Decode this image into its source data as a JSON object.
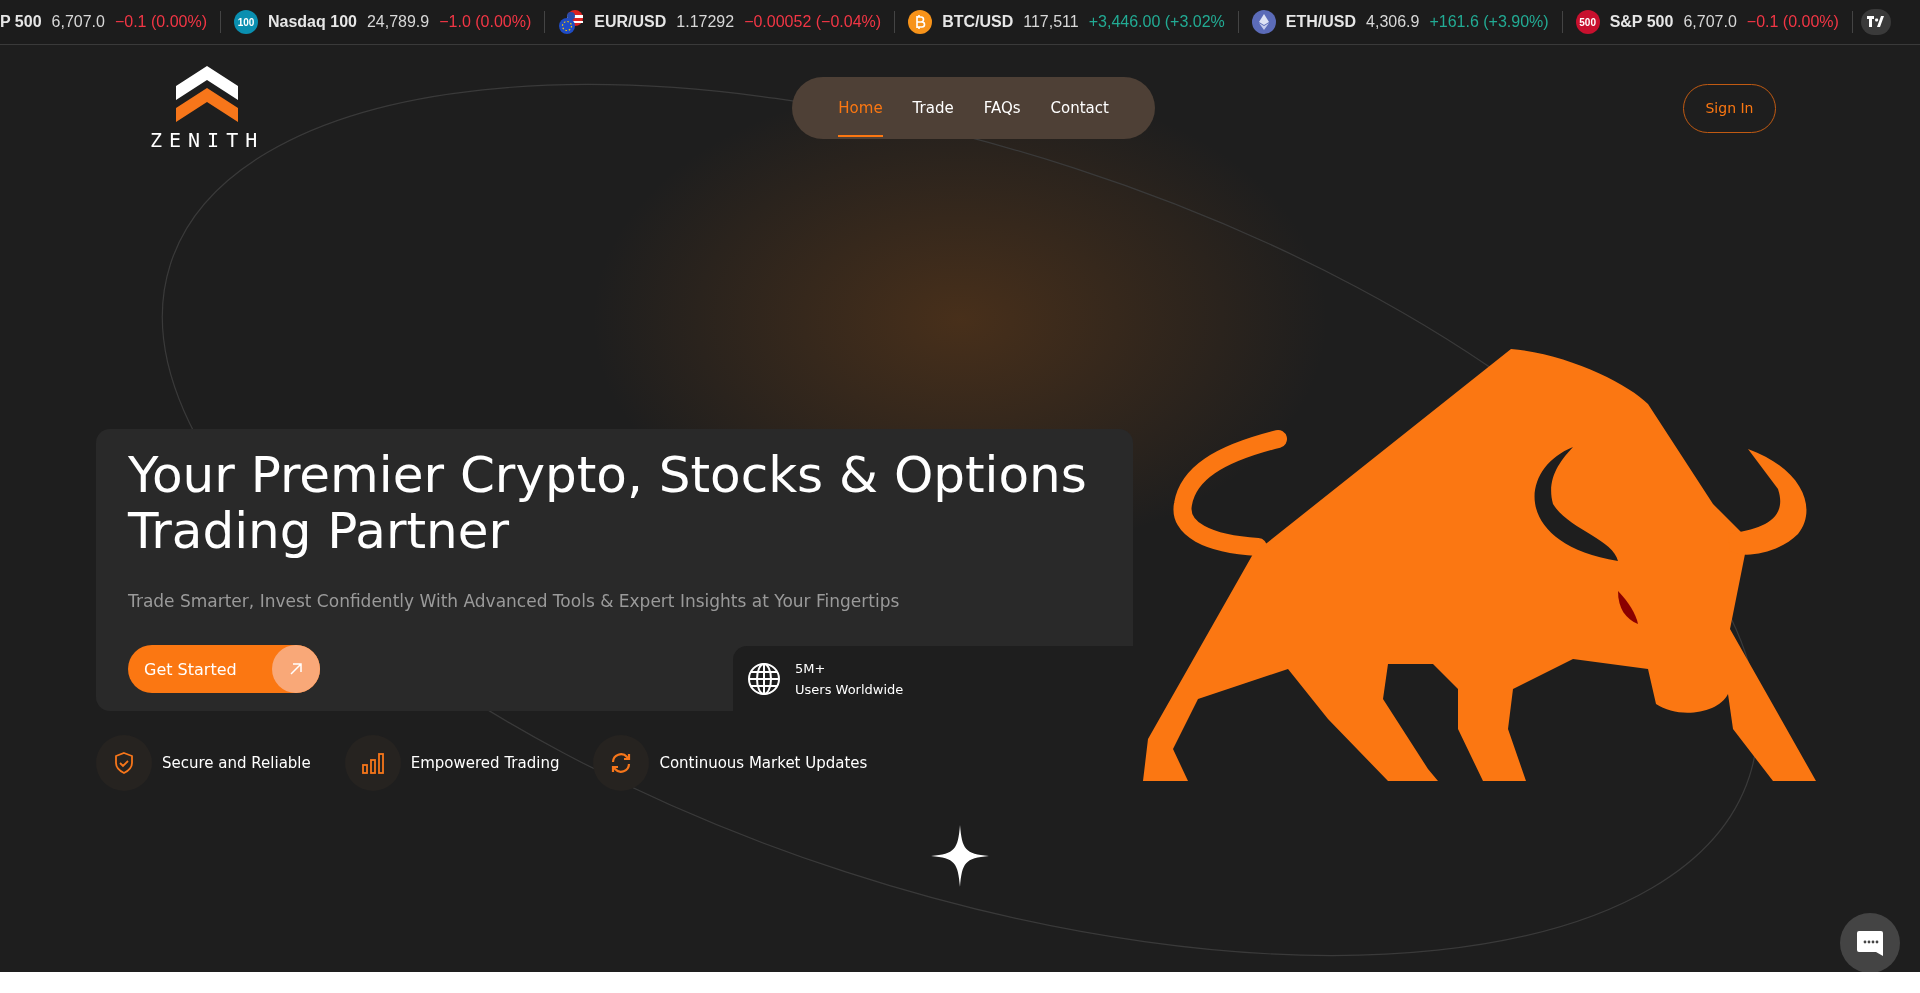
{
  "ticker": [
    {
      "kind": "plain",
      "symbol": "P 500",
      "price": "6,707.0",
      "change": "−0.1 (0.00%)",
      "color": "#f23645"
    },
    {
      "kind": "badge",
      "badge": {
        "text": "100",
        "color": "#0a8fb0"
      },
      "symbol": "Nasdaq 100",
      "price": "24,789.9",
      "change": "−1.0 (0.00%)",
      "color": "#f23645"
    },
    {
      "kind": "flags",
      "symbol": "EUR/USD",
      "price": "1.17292",
      "change": "−0.00052 (−0.04%)",
      "color": "#f23645"
    },
    {
      "kind": "bitcoin",
      "symbol": "BTC/USD",
      "price": "117,511",
      "change": "+3,446.00 (+3.02%",
      "color": "#22ab94"
    },
    {
      "kind": "ethereum",
      "symbol": "ETH/USD",
      "price": "4,306.9",
      "change": "+161.6 (+3.90%)",
      "color": "#22ab94"
    },
    {
      "kind": "badge",
      "badge": {
        "text": "500",
        "color": "#c8102e"
      },
      "symbol": "S&P 500",
      "price": "6,707.0",
      "change": "−0.1 (0.00%)",
      "color": "#f23645"
    }
  ],
  "logo": {
    "text": "ZENITH"
  },
  "nav": [
    {
      "label": "Home",
      "selected": true
    },
    {
      "label": "Trade",
      "selected": false
    },
    {
      "label": "FAQs",
      "selected": false
    },
    {
      "label": "Contact",
      "selected": false
    }
  ],
  "sign_in": "Sign In",
  "hero": {
    "title": "Your Premier Crypto, Stocks & Options Trading Partner",
    "subtitle": "Trade Smarter, Invest Confidently With Advanced Tools & Expert Insights at Your Fingertips",
    "cta": "Get Started"
  },
  "stats": {
    "value": "5M+",
    "label": "Users Worldwide"
  },
  "features": [
    {
      "kind": "shield",
      "label": "Secure and Reliable"
    },
    {
      "kind": "bars",
      "label": "Empowered Trading"
    },
    {
      "kind": "refresh",
      "label": "Continuous Market Updates"
    }
  ]
}
